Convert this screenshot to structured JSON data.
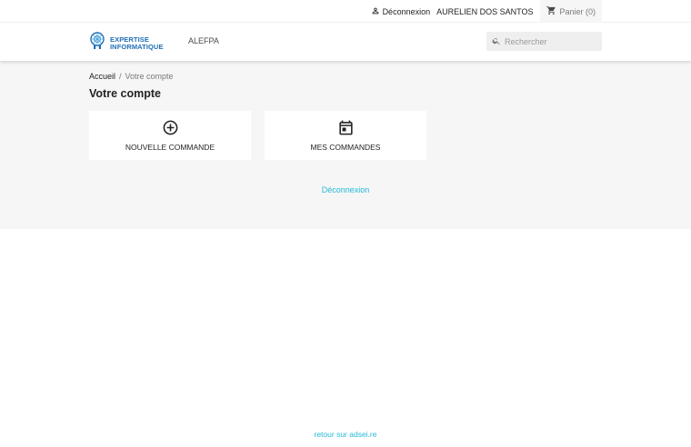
{
  "topbar": {
    "logout_label": "Déconnexion",
    "user_name": "AURELIEN DOS SANTOS",
    "cart_label": "Panier (0)"
  },
  "header": {
    "logo_line1": "EXPERTISE",
    "logo_line2": "INFORMATIQUE",
    "nav_item": "ALEFPA",
    "search_placeholder": "Rechercher"
  },
  "breadcrumb": {
    "home": "Accueil",
    "separator": "/",
    "current": "Votre compte"
  },
  "page": {
    "title": "Votre compte",
    "cards": [
      {
        "label": "NOUVELLE COMMANDE",
        "icon": "add-circle-icon"
      },
      {
        "label": "MES COMMANDES",
        "icon": "calendar-icon"
      }
    ],
    "logout_link": "Déconnexion"
  },
  "footer": {
    "link": "retour sur adsei.re"
  },
  "colors": {
    "accent": "#24b9d7",
    "logo_blue": "#1f6fb6",
    "main_bg": "#f6f6f6"
  }
}
